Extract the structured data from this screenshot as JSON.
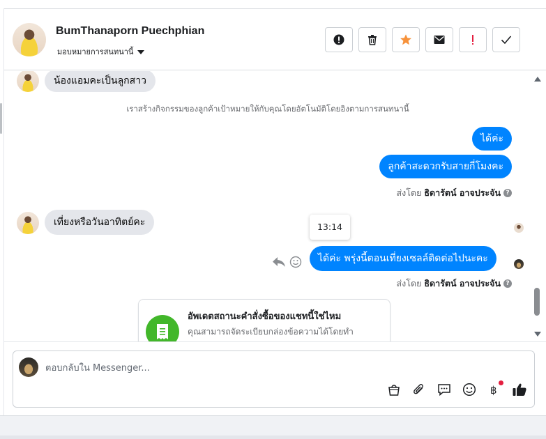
{
  "header": {
    "contact_name": "BumThanaporn Puechphian",
    "assign_label": "มอบหมายการสนทนานี้",
    "actions": [
      {
        "name": "spam-button",
        "icon": "alert-circle-icon"
      },
      {
        "name": "delete-button",
        "icon": "trash-icon"
      },
      {
        "name": "star-button",
        "icon": "star-icon"
      },
      {
        "name": "mark-unread-button",
        "icon": "envelope-icon"
      },
      {
        "name": "important-button",
        "icon": "exclamation-icon"
      },
      {
        "name": "mark-done-button",
        "icon": "check-icon"
      }
    ]
  },
  "messages": {
    "incoming_1": "น้องแอมคะเป็นลูกสาว",
    "system_note": "เราสร้างกิจกรรมของลูกค้าเป้าหมายให้กับคุณโดยอัตโนมัติโดยอิงตามการสนทนานี้",
    "outgoing_1": "ได้ค่ะ",
    "outgoing_2": "ลูกค้าสะดวกรับสายกี่โมงคะ",
    "sent_by_label_1": "ส่งโดย",
    "sent_by_name_1": "ธิดารัตน์ อาจประจัน",
    "incoming_2": "เที่ยงหรือวันอาทิตย์คะ",
    "tooltip_time": "13:14",
    "outgoing_3": "ได้ค่ะ พรุ่งนี้ตอนเที่ยงเซลล์ติดต่อไปนะคะ",
    "sent_by_label_2": "ส่งโดย",
    "sent_by_name_2": "ธิดารัตน์ อาจประจัน",
    "help_mark": "?"
  },
  "card": {
    "title": "อัพเดตสถานะคำสั่งซื้อของแชทนี้ใช่ไหม",
    "description": "คุณสามารถจัดระเบียบกล่องข้อความได้โดยทำ"
  },
  "composer": {
    "placeholder": "ตอบกลับใน Messenger...",
    "tools": [
      "bag-icon",
      "paperclip-icon",
      "saved-reply-icon",
      "emoji-icon",
      "baht-icon",
      "thumbs-up-icon"
    ]
  },
  "colors": {
    "accent": "#0084ff",
    "star": "#f7923b",
    "important": "#e41e3f",
    "card_icon": "#42b72a"
  }
}
